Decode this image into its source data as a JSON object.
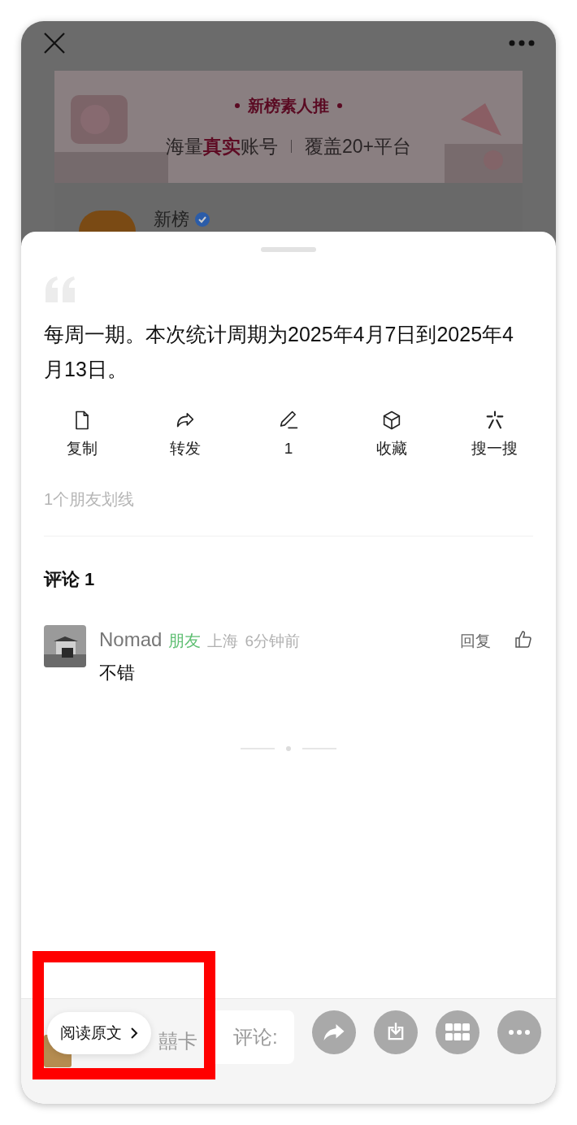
{
  "background": {
    "banner": {
      "title": "新榜素人推",
      "tagline": "海量**真实**账号",
      "tagline_2": "覆盖20+平台"
    },
    "account": {
      "name": "新榜",
      "verified": true
    }
  },
  "quote": {
    "text": "每周一期。本次统计周期为2025年4月7日到2025年4月13日。"
  },
  "actions": [
    {
      "kind": "copy",
      "label": "复制"
    },
    {
      "kind": "forward",
      "label": "转发"
    },
    {
      "kind": "underline",
      "label": "1"
    },
    {
      "kind": "favorite",
      "label": "收藏"
    },
    {
      "kind": "search",
      "label": "搜一搜"
    }
  ],
  "highlight_count": "1个朋友划线",
  "comments_title": "评论 1",
  "comments": [
    {
      "name": "Nomad",
      "tag": "朋友",
      "location": "上海",
      "time": "6分钟前",
      "reply": "回复",
      "text": "不错"
    }
  ],
  "bottom_bar": {
    "card_label": "囍卡",
    "input_placeholder": "评论:",
    "buttons": [
      {
        "kind": "share"
      },
      {
        "kind": "download"
      },
      {
        "kind": "grid"
      },
      {
        "kind": "more"
      }
    ]
  },
  "read_original": {
    "label": "阅读原文"
  },
  "annotation": {
    "kind": "highlight-box"
  }
}
